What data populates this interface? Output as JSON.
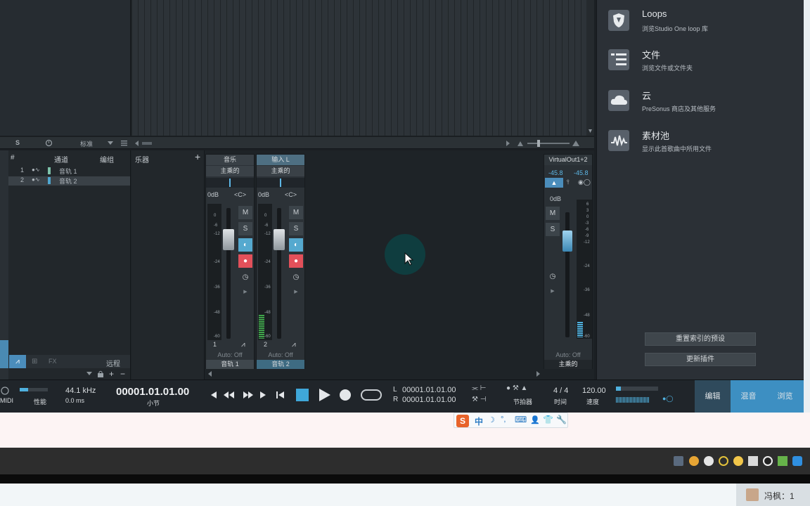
{
  "browser": {
    "items": [
      {
        "title": "Loops",
        "subtitle": "浏览Studio One loop 库",
        "icon": "shield-icon"
      },
      {
        "title": "文件",
        "subtitle": "浏览文件或文件夹",
        "icon": "file-list-icon"
      },
      {
        "title": "云",
        "subtitle": "PreSonus 商店及其他服务",
        "icon": "cloud-icon"
      },
      {
        "title": "素材池",
        "subtitle": "显示此首歌曲中所用文件",
        "icon": "waveform-icon"
      }
    ],
    "reset_index_button": "重置索引的预设",
    "update_plugins_button": "更新插件"
  },
  "arrange_toolbar": {
    "s_label": "S",
    "zoom_label": "标准"
  },
  "channel_list": {
    "headers": {
      "number": "#",
      "channel": "通道",
      "edit": "编组",
      "instrument": "乐器",
      "add": "+"
    },
    "tracks": [
      {
        "num": "1",
        "name": "音轨 1"
      },
      {
        "num": "2",
        "name": "音轨 2"
      }
    ],
    "remote_label": "远程",
    "fx_label": "FX"
  },
  "strips": [
    {
      "name": "音乐",
      "bus": "主乘的",
      "db": "0dB",
      "pan": "<C>",
      "mute": "M",
      "solo": "S",
      "num": "1",
      "auto": "Auto: Off",
      "track": "音轨 1"
    },
    {
      "name": "输入 L",
      "bus": "主乘的",
      "db": "0dB",
      "pan": "<C>",
      "mute": "M",
      "solo": "S",
      "num": "2",
      "auto": "Auto: Off",
      "track": "音轨 2"
    }
  ],
  "scale": [
    "0",
    "-6",
    "-12",
    "-24",
    "-36",
    "-48",
    "-60"
  ],
  "master": {
    "name": "VirtualOut1+2",
    "peak_l": "-45.8",
    "peak_r": "-45.8",
    "db": "0dB",
    "mute": "M",
    "solo": "S",
    "auto": "Auto: Off",
    "track": "主乘的",
    "scale": [
      "6",
      "3",
      "0",
      "-3",
      "-6",
      "-9",
      "-12",
      "-24",
      "-36",
      "-48",
      "-60"
    ]
  },
  "transport": {
    "midi_label": "MIDI",
    "perf_label": "性能",
    "sample_rate": "44.1 kHz",
    "latency": "0.0 ms",
    "position": "00001.01.01.00",
    "position_unit": "小节",
    "left_locator_label": "L",
    "left_locator": "00001.01.01.00",
    "right_locator_label": "R",
    "right_locator": "00001.01.01.00",
    "metronome_label": "节拍器",
    "time_sig": "4 / 4",
    "time_label": "时间",
    "tempo": "120.00",
    "tempo_label": "速度"
  },
  "view_tabs": [
    "编辑",
    "混音",
    "浏览"
  ],
  "ime": {
    "lang": "中"
  },
  "user": {
    "label": "冯枫：1"
  }
}
